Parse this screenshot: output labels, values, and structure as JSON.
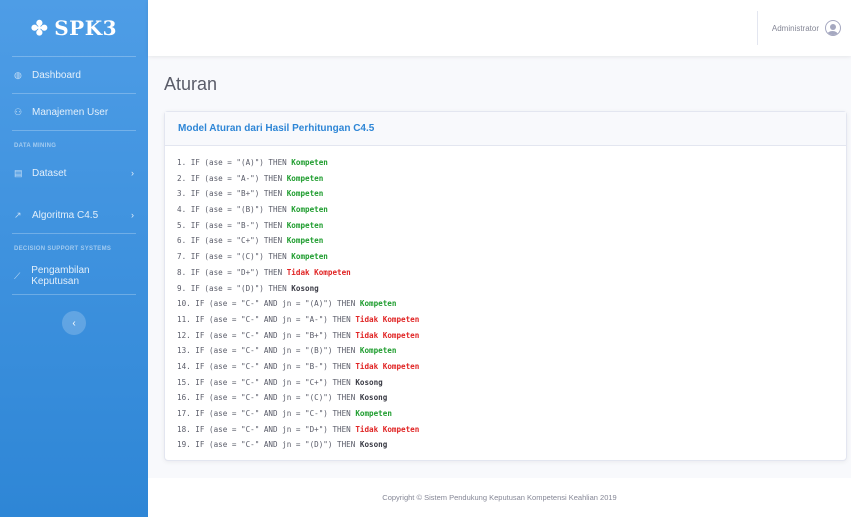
{
  "brand": {
    "icon": "cogs-icon",
    "name": "SPK3"
  },
  "sidebar": {
    "items": [
      {
        "label": "Dashboard",
        "icon": "dashboard-icon"
      },
      {
        "label": "Manajemen User",
        "icon": "users-icon"
      }
    ],
    "heading_data_mining": "DATA MINING",
    "data_mining_items": [
      {
        "label": "Dataset",
        "icon": "database-icon",
        "chevron": "›"
      },
      {
        "label": "Algoritma C4.5",
        "icon": "wrench-icon",
        "chevron": "›"
      }
    ],
    "heading_dss": "DECISION SUPPORT SYSTEMS",
    "dss_items": [
      {
        "label": "Pengambilan Keputusan",
        "icon": "chart-icon"
      }
    ],
    "toggle_glyph": "‹"
  },
  "topbar": {
    "user_name": "Administrator",
    "avatar_icon": "user-circle-icon"
  },
  "page": {
    "title": "Aturan"
  },
  "card": {
    "header": "Model Aturan dari Hasil Perhitungan C4.5"
  },
  "rules": [
    {
      "text": "1. IF (ase = \"(A)\") THEN ",
      "outcome": "Kompeten",
      "kind": "kompeten"
    },
    {
      "text": "2. IF (ase = \"A-\") THEN ",
      "outcome": "Kompeten",
      "kind": "kompeten"
    },
    {
      "text": "3. IF (ase = \"B+\") THEN ",
      "outcome": "Kompeten",
      "kind": "kompeten"
    },
    {
      "text": "4. IF (ase = \"(B)\") THEN ",
      "outcome": "Kompeten",
      "kind": "kompeten"
    },
    {
      "text": "5. IF (ase = \"B-\") THEN ",
      "outcome": "Kompeten",
      "kind": "kompeten"
    },
    {
      "text": "6. IF (ase = \"C+\") THEN ",
      "outcome": "Kompeten",
      "kind": "kompeten"
    },
    {
      "text": "7. IF (ase = \"(C)\") THEN ",
      "outcome": "Kompeten",
      "kind": "kompeten"
    },
    {
      "text": "8. IF (ase = \"D+\") THEN ",
      "outcome": "Tidak Kompeten",
      "kind": "tidak"
    },
    {
      "text": "9. IF (ase = \"(D)\") THEN ",
      "outcome": "Kosong",
      "kind": "kosong"
    },
    {
      "text": "10. IF (ase = \"C-\" AND jn = \"(A)\") THEN ",
      "outcome": "Kompeten",
      "kind": "kompeten"
    },
    {
      "text": "11. IF (ase = \"C-\" AND jn = \"A-\") THEN ",
      "outcome": "Tidak Kompeten",
      "kind": "tidak"
    },
    {
      "text": "12. IF (ase = \"C-\" AND jn = \"B+\") THEN ",
      "outcome": "Tidak Kompeten",
      "kind": "tidak"
    },
    {
      "text": "13. IF (ase = \"C-\" AND jn = \"(B)\") THEN ",
      "outcome": "Kompeten",
      "kind": "kompeten"
    },
    {
      "text": "14. IF (ase = \"C-\" AND jn = \"B-\") THEN ",
      "outcome": "Tidak Kompeten",
      "kind": "tidak"
    },
    {
      "text": "15. IF (ase = \"C-\" AND jn = \"C+\") THEN ",
      "outcome": "Kosong",
      "kind": "kosong"
    },
    {
      "text": "16. IF (ase = \"C-\" AND jn = \"(C)\") THEN ",
      "outcome": "Kosong",
      "kind": "kosong"
    },
    {
      "text": "17. IF (ase = \"C-\" AND jn = \"C-\") THEN ",
      "outcome": "Kompeten",
      "kind": "kompeten"
    },
    {
      "text": "18. IF (ase = \"C-\" AND jn = \"D+\") THEN ",
      "outcome": "Tidak Kompeten",
      "kind": "tidak"
    },
    {
      "text": "19. IF (ase = \"C-\" AND jn = \"(D)\") THEN ",
      "outcome": "Kosong",
      "kind": "kosong"
    }
  ],
  "colors": {
    "sidebar": "#2e86d6",
    "kompeten": "#1f9d2f",
    "tidak_kompeten": "#e02424",
    "kosong": "#3a3b45"
  },
  "footer": {
    "text": "Copyright © Sistem Pendukung Keputusan Kompetensi Keahlian 2019"
  }
}
